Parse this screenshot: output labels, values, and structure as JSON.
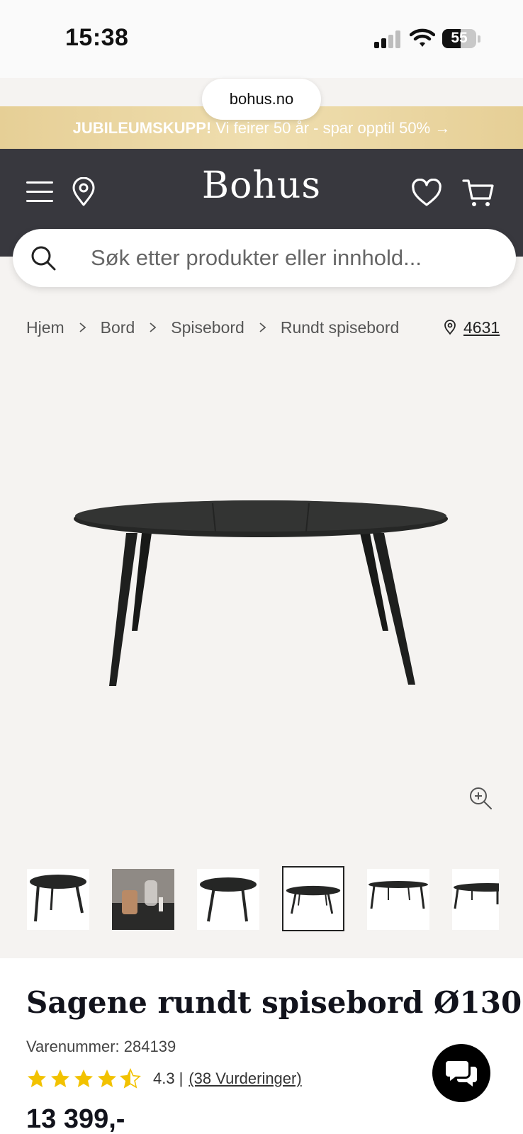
{
  "status_bar": {
    "time": "15:38",
    "battery": "55"
  },
  "browser": {
    "url": "bohus.no"
  },
  "promo": {
    "highlight": "JUBILEUMSKUPP!",
    "text": "Vi feirer 50 år - spar opptil 50% →"
  },
  "header": {
    "logo": "Bohus"
  },
  "search": {
    "placeholder": "Søk etter produkter eller innhold..."
  },
  "breadcrumb": {
    "items": [
      "Hjem",
      "Bord",
      "Spisebord",
      "Rundt spisebord"
    ]
  },
  "postcode": "4631",
  "gallery": {
    "thumbnail_count": 6,
    "selected_index": 3
  },
  "product": {
    "title": "Sagene rundt spisebord Ø130",
    "sku_label": "Varenummer:",
    "sku": "284139",
    "rating": "4.3",
    "rating_separator": "|",
    "rating_value": 4.5,
    "reviews_link": "(38 Vurderinger)",
    "price": "13 399,-"
  },
  "colors": {
    "header_bg": "#38383e",
    "promo_bg": "#e8d29c",
    "page_bg": "#f5f3f1",
    "star": "#f2c200",
    "title": "#12131c"
  }
}
